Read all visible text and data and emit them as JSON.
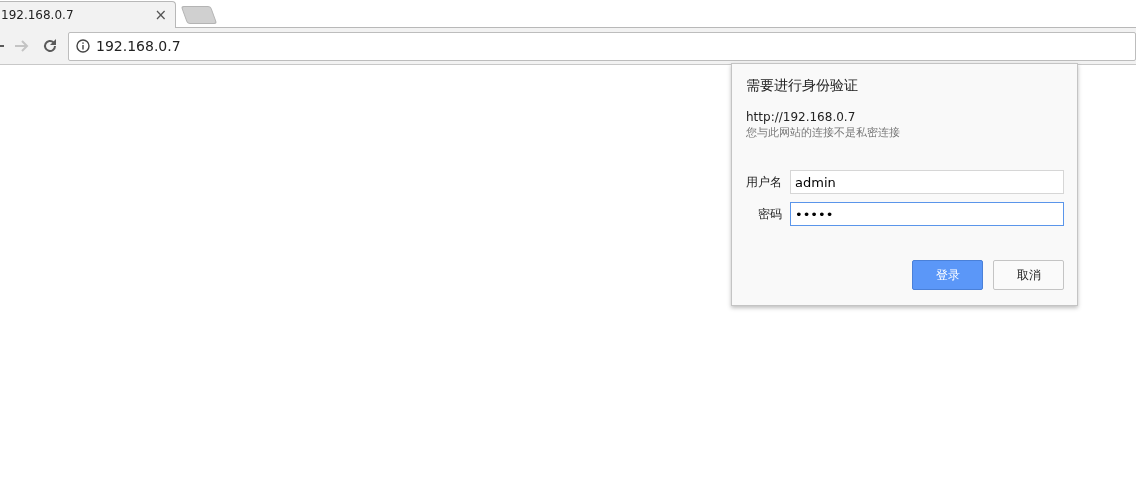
{
  "tabs": [
    {
      "title": "192.168.0.7",
      "close": "×",
      "selected": true
    }
  ],
  "address_bar": {
    "url": "192.168.0.7"
  },
  "auth_dialog": {
    "title": "需要进行身份验证",
    "origin": "http://192.168.0.7",
    "warning": "您与此网站的连接不是私密连接",
    "fields": [
      {
        "label": "用户名",
        "value": "admin",
        "focused": false
      },
      {
        "label": "密码",
        "value": "•••••",
        "focused": true
      }
    ],
    "buttons": [
      {
        "label": "登录",
        "kind": "primary"
      },
      {
        "label": "取消",
        "kind": "secondary"
      }
    ]
  }
}
